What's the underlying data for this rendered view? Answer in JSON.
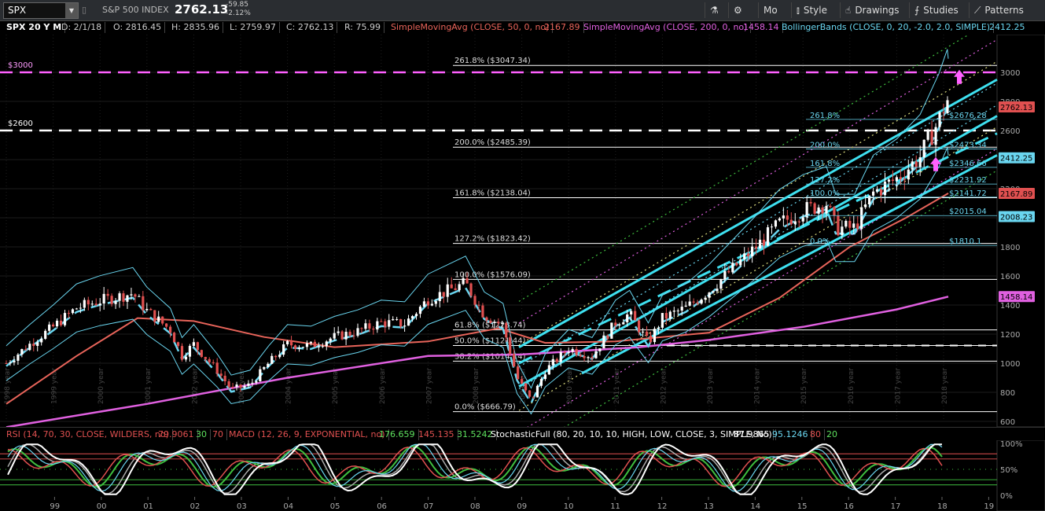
{
  "toolbar": {
    "symbol": "SPX",
    "description": "S&P 500 INDEX",
    "last": "2762.13",
    "change": "-59.85",
    "change_pct": "-2.12%",
    "buttons": [
      {
        "label": "",
        "icon": "flask-icon"
      },
      {
        "label": "",
        "icon": "gear-icon"
      },
      {
        "label": "Mo",
        "icon": ""
      },
      {
        "label": "Style",
        "icon": "candles-icon"
      },
      {
        "label": "Drawings",
        "icon": "hand-icon"
      },
      {
        "label": "Studies",
        "icon": "studies-icon"
      },
      {
        "label": "Patterns",
        "icon": "patterns-icon"
      }
    ]
  },
  "infobar": {
    "symbol_period": "SPX 20 Y M",
    "date": "D: 2/1/18",
    "open": "O: 2816.45",
    "high": "H: 2835.96",
    "low": "L: 2759.97",
    "close": "C: 2762.13",
    "range": "R: 75.99",
    "sma50_label": "SimpleMovingAvg (CLOSE, 50, 0, no)",
    "sma50_value": "2167.89",
    "sma200_label": "SimpleMovingAvg (CLOSE, 200, 0, no)",
    "sma200_value": "1458.14",
    "bb_label": "BollingerBands (CLOSE, 0, 20, -2.0, 2.0, SIMPLE)",
    "bb_value": "2412.25"
  },
  "lowerbar": {
    "rsi_label": "RSI (14, 70, 30, CLOSE, WILDERS, no)",
    "rsi_value": "79.9061",
    "rsi_ob": "30",
    "rsi_os": "70",
    "macd_label": "MACD (12, 26, 9, EXPONENTIAL, no)",
    "macd_v1": "176.659",
    "macd_v2": "145.135",
    "macd_v3": "31.5242",
    "stoch_label": "StochasticFull (80, 20, 10, 10, HIGH, LOW, CLOSE, 3, SIMPLE, No)",
    "stoch_v1": "87.9865",
    "stoch_v2": "95.1246",
    "stoch_v3": "80",
    "stoch_v4": "20"
  },
  "colors": {
    "up": "#ffffff",
    "down": "#e05050",
    "sma50": "#e8645a",
    "sma200": "#e060e0",
    "bollinger": "#6ad6f0",
    "channel": "#3ee0f0",
    "level_3000": "#ff60ff"
  },
  "chart_data": {
    "type": "candlestick",
    "price_axis": {
      "min": 600,
      "max": 3100,
      "ticks": [
        600,
        800,
        1000,
        1200,
        1400,
        1600,
        1800,
        2000,
        2200,
        2400,
        2600,
        2800,
        3000
      ]
    },
    "x_axis": {
      "start_year": 1998,
      "end_year": 2019,
      "year_labels": [
        "1998 year",
        "1999 year",
        "2000 year",
        "2001 year",
        "2002 year",
        "2003 year",
        "2004 year",
        "2005 year",
        "2006 year",
        "2007 year",
        "2008 year",
        "2009 year",
        "2010 year",
        "2011 year",
        "2012 year",
        "2013 year",
        "2014 year",
        "2015 year",
        "2016 year",
        "2017 year",
        "2018 year"
      ]
    },
    "close_path": [
      [
        1998.0,
        1000
      ],
      [
        1998.5,
        1130
      ],
      [
        1999.0,
        1250
      ],
      [
        1999.5,
        1380
      ],
      [
        2000.0,
        1430
      ],
      [
        2000.7,
        1480
      ],
      [
        2001.0,
        1360
      ],
      [
        2001.5,
        1230
      ],
      [
        2001.75,
        1050
      ],
      [
        2002.0,
        1130
      ],
      [
        2002.5,
        950
      ],
      [
        2002.8,
        820
      ],
      [
        2003.2,
        850
      ],
      [
        2003.6,
        1000
      ],
      [
        2004.0,
        1130
      ],
      [
        2004.5,
        1120
      ],
      [
        2005.0,
        1180
      ],
      [
        2005.5,
        1220
      ],
      [
        2006.0,
        1280
      ],
      [
        2006.5,
        1270
      ],
      [
        2007.0,
        1440
      ],
      [
        2007.8,
        1550
      ],
      [
        2008.2,
        1330
      ],
      [
        2008.6,
        1260
      ],
      [
        2008.9,
        900
      ],
      [
        2009.2,
        740
      ],
      [
        2009.5,
        950
      ],
      [
        2010.0,
        1100
      ],
      [
        2010.5,
        1050
      ],
      [
        2011.0,
        1280
      ],
      [
        2011.3,
        1340
      ],
      [
        2011.7,
        1140
      ],
      [
        2012.0,
        1310
      ],
      [
        2012.5,
        1380
      ],
      [
        2013.0,
        1500
      ],
      [
        2013.5,
        1650
      ],
      [
        2014.0,
        1800
      ],
      [
        2014.5,
        1960
      ],
      [
        2015.0,
        2050
      ],
      [
        2015.5,
        2100
      ],
      [
        2015.7,
        1930
      ],
      [
        2016.1,
        1930
      ],
      [
        2016.5,
        2170
      ],
      [
        2017.0,
        2270
      ],
      [
        2017.5,
        2420
      ],
      [
        2017.9,
        2670
      ],
      [
        2018.08,
        2820
      ],
      [
        2018.1,
        2762
      ]
    ],
    "fib_left": {
      "anchor_low": 666.79,
      "levels": [
        {
          "label": "261.8%",
          "price": 3047.34
        },
        {
          "label": "200.0%",
          "price": 2485.39
        },
        {
          "label": "161.8%",
          "price": 2138.04
        },
        {
          "label": "127.2%",
          "price": 1823.42
        },
        {
          "label": "100.0%",
          "price": 1576.09
        },
        {
          "label": "61.8%",
          "price": 1228.74
        },
        {
          "label": "50.0%",
          "price": 1121.44
        },
        {
          "label": "38.2%",
          "price": 1014.14
        },
        {
          "label": "0.0%",
          "price": 666.79
        }
      ]
    },
    "fib_right": [
      {
        "label": "261.8%",
        "value": "$2676.28",
        "price": 2676.28
      },
      {
        "label": "200.0%",
        "value": "$2473.34",
        "price": 2473.34
      },
      {
        "label": "161.8%",
        "value": "$2346.66",
        "price": 2346.66
      },
      {
        "label": "127.2%",
        "value": "$2231.92",
        "price": 2231.92
      },
      {
        "label": "100.0%",
        "value": "$2141.72",
        "price": 2141.72
      },
      {
        "label": "",
        "value": "$2015.04",
        "price": 2015.04
      },
      {
        "label": "0.0%",
        "value": "$1810.1",
        "price": 1810.1
      }
    ],
    "horizontal_levels": [
      {
        "label": "$3000",
        "price": 3000
      },
      {
        "label": "$2600",
        "price": 2600
      }
    ],
    "price_badges": [
      {
        "value": "2762.13",
        "price": 2762.13,
        "color": "#e05050"
      },
      {
        "value": "2412.25",
        "price": 2412.25,
        "color": "#6ad6f0"
      },
      {
        "value": "2167.89",
        "price": 2167.89,
        "color": "#e05050"
      },
      {
        "value": "2008.23",
        "price": 2008.23,
        "color": "#6ad6f0"
      },
      {
        "value": "1458.14",
        "price": 1458.14,
        "color": "#e060e0"
      }
    ],
    "sma200_path": [
      [
        1998.0,
        560
      ],
      [
        2001.0,
        720
      ],
      [
        2004.0,
        900
      ],
      [
        2007.0,
        1050
      ],
      [
        2009.0,
        1060
      ],
      [
        2011.5,
        1110
      ],
      [
        2013.0,
        1160
      ],
      [
        2015.0,
        1250
      ],
      [
        2017.0,
        1370
      ],
      [
        2018.1,
        1458
      ]
    ],
    "sma50_path": [
      [
        1998.0,
        720
      ],
      [
        1999.5,
        1050
      ],
      [
        2000.8,
        1310
      ],
      [
        2002.0,
        1290
      ],
      [
        2003.5,
        1180
      ],
      [
        2005.0,
        1110
      ],
      [
        2007.0,
        1150
      ],
      [
        2008.5,
        1240
      ],
      [
        2009.5,
        1140
      ],
      [
        2011.0,
        1150
      ],
      [
        2013.0,
        1210
      ],
      [
        2014.5,
        1450
      ],
      [
        2016.0,
        1800
      ],
      [
        2017.2,
        2000
      ],
      [
        2018.1,
        2168
      ]
    ],
    "lower_axis": {
      "ticks": [
        "0%",
        "50%",
        "100%"
      ],
      "year_labels": [
        "99",
        "00",
        "01",
        "02",
        "03",
        "04",
        "05",
        "06",
        "07",
        "08",
        "09",
        "10",
        "11",
        "12",
        "13",
        "14",
        "15",
        "16",
        "17",
        "18",
        "19"
      ]
    }
  }
}
